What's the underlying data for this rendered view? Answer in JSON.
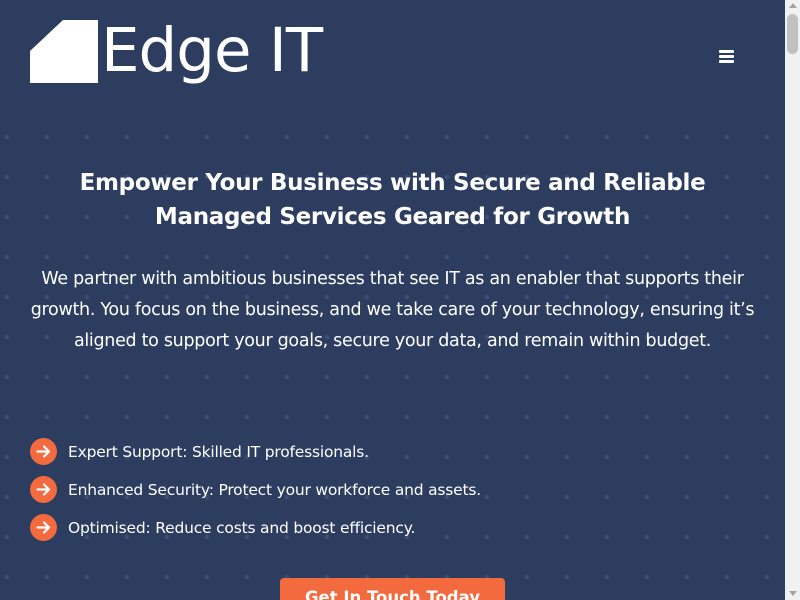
{
  "brand": {
    "name": "Edge IT",
    "logo_icon": "house-shape-logo",
    "logo_color": "#ffffff"
  },
  "header": {
    "menu_icon": "hamburger-menu-icon"
  },
  "hero": {
    "title": "Empower Your Business with Secure and Reliable Managed Services Geared for Growth",
    "description": "We partner with ambitious businesses that see IT as an enabler that supports their growth. You focus on the business, and we take care of your technology, ensuring it’s aligned to support your goals, secure your data, and remain within budget."
  },
  "features": [
    {
      "icon": "arrow-right-icon",
      "title": "Expert Support:",
      "text": " Skilled IT professionals."
    },
    {
      "icon": "arrow-right-icon",
      "title": "Enhanced Security:",
      "text": " Protect your workforce and assets."
    },
    {
      "icon": "arrow-right-icon",
      "title": "Optimised:",
      "text": " Reduce costs and boost efficiency."
    }
  ],
  "cta": {
    "label": "Get In Touch Today"
  },
  "colors": {
    "background": "#2c3d5f",
    "accent": "#f26a3d",
    "text": "#ffffff"
  }
}
